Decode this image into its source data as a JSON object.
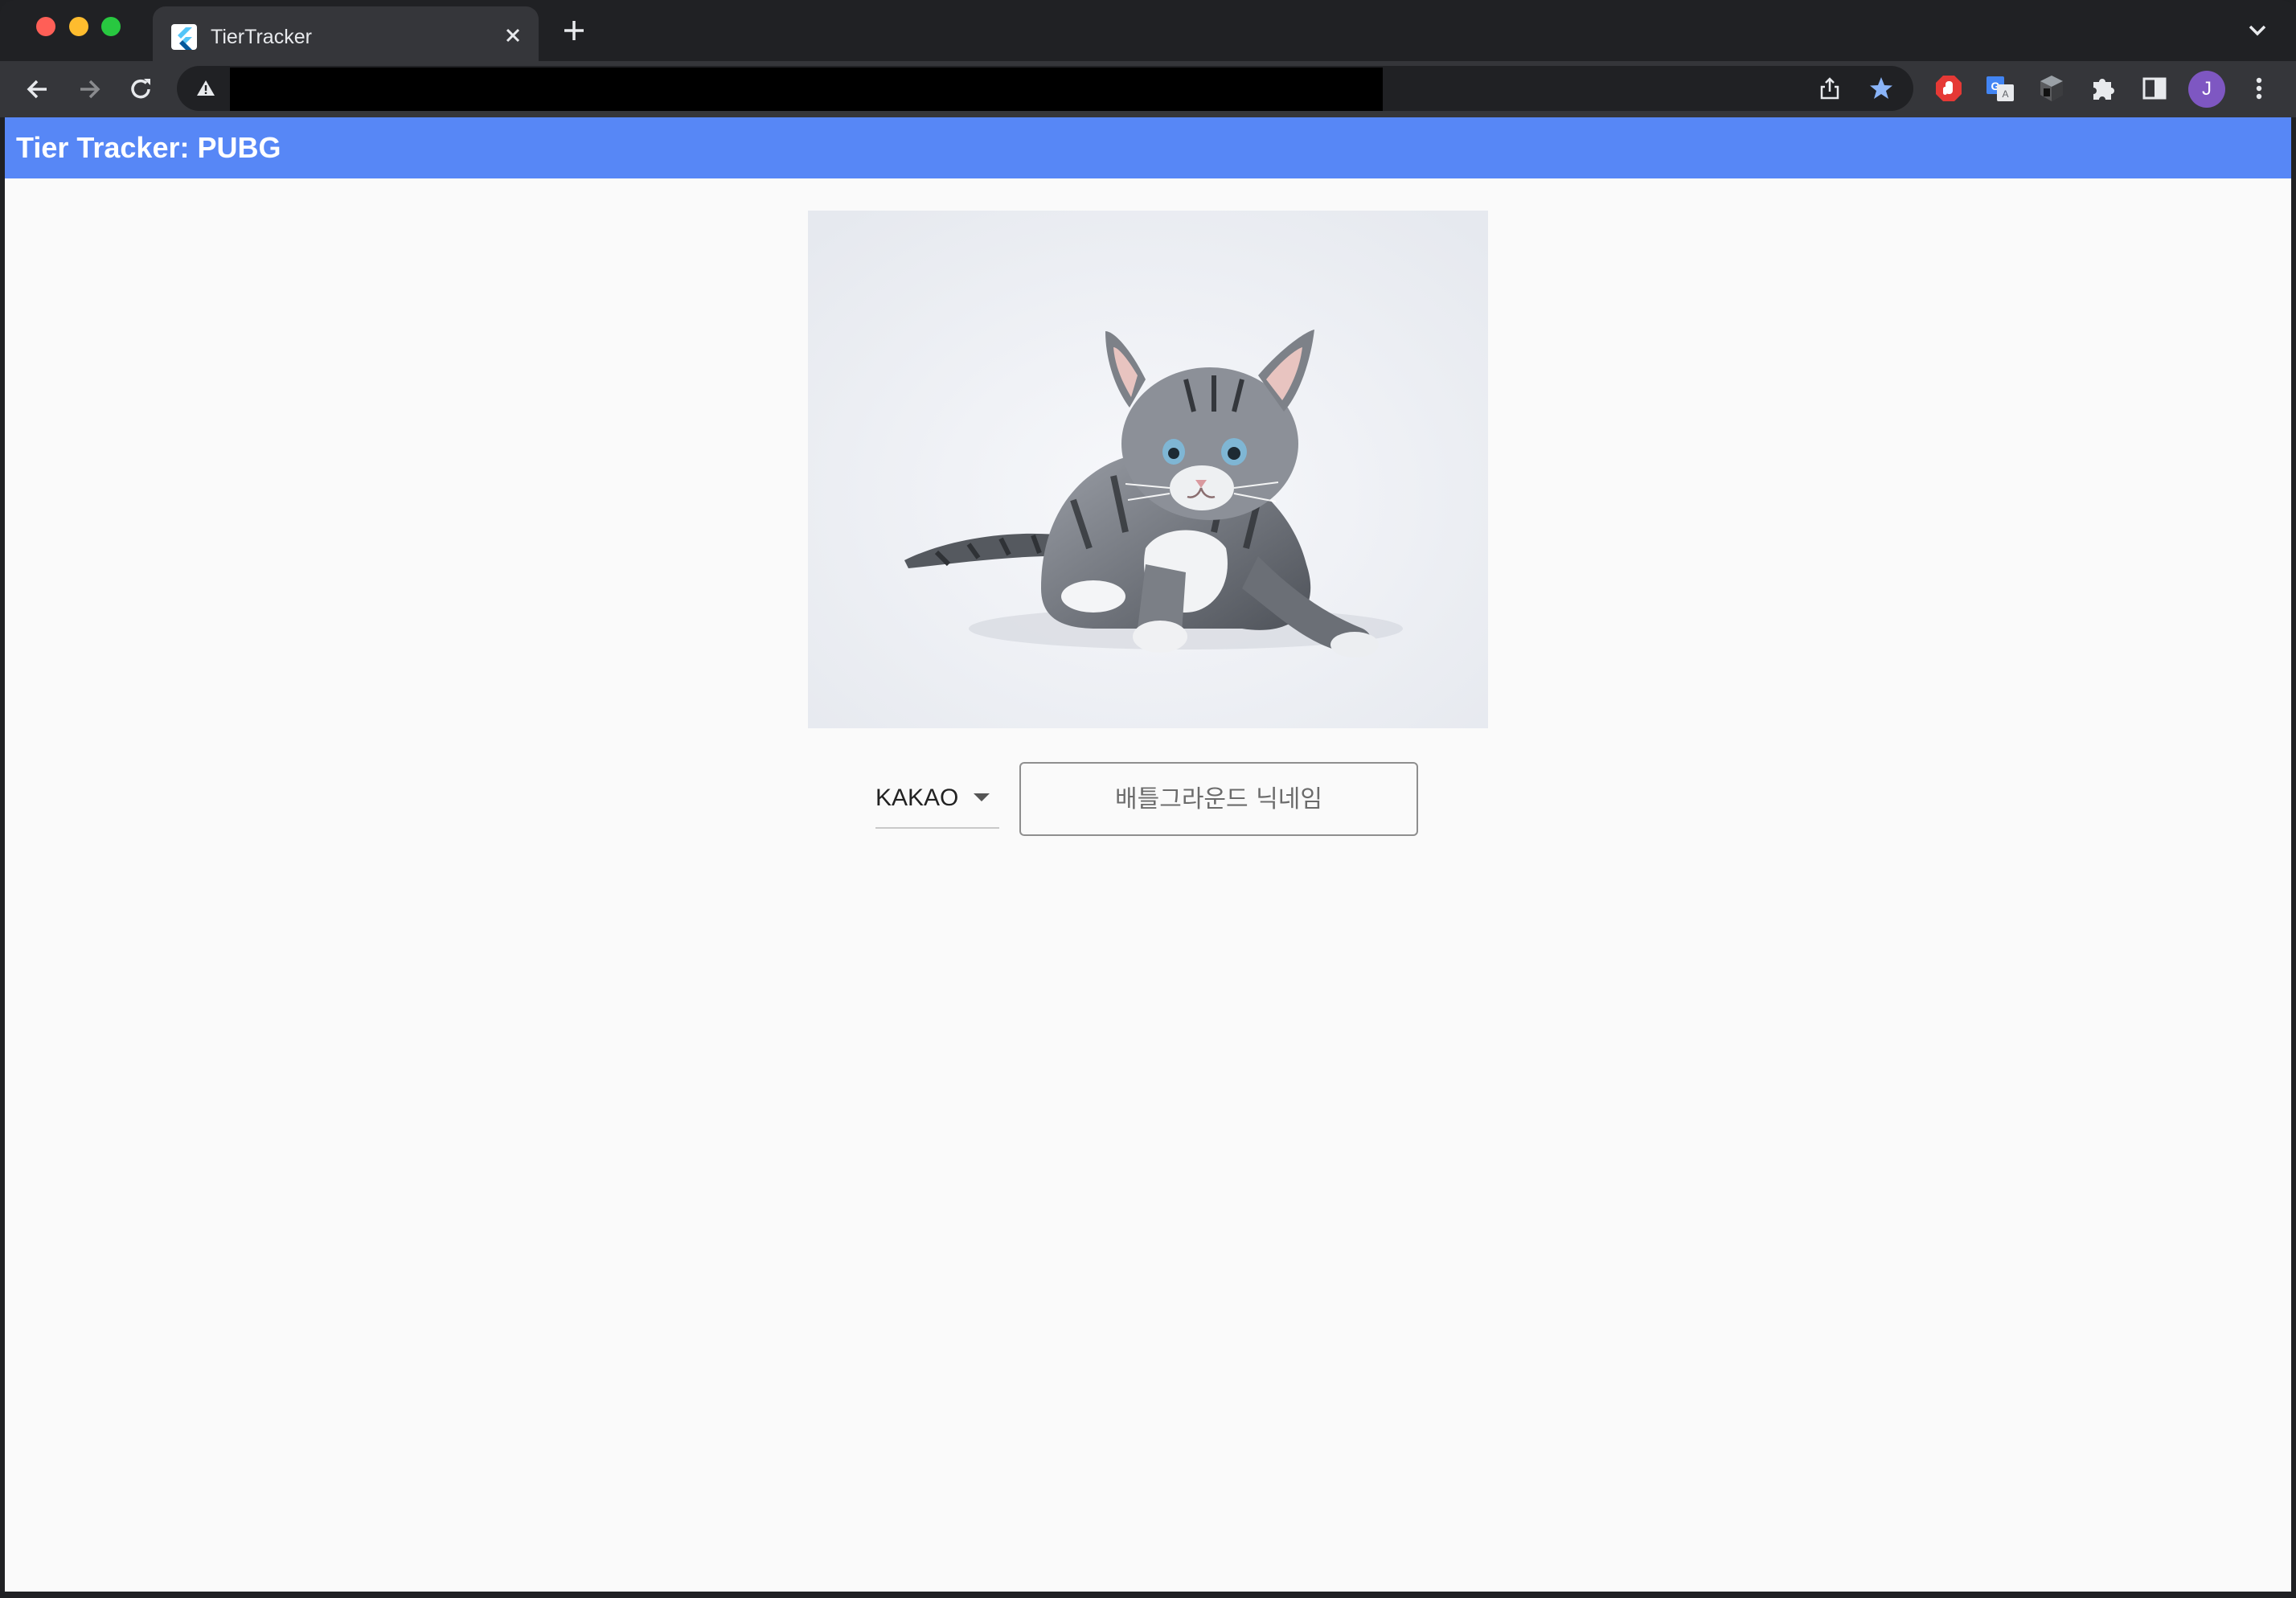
{
  "browser": {
    "tab": {
      "title": "TierTracker",
      "close_icon": "close-icon"
    },
    "new_tab_icon": "plus-icon",
    "tab_search_icon": "chevron-down-icon",
    "toolbar": {
      "back_icon": "arrow-left-icon",
      "forward_icon": "arrow-right-icon",
      "reload_icon": "reload-icon",
      "security_icon": "warning-icon",
      "share_icon": "share-icon",
      "bookmark_icon": "star-icon",
      "extensions": [
        "adblock-icon",
        "translate-icon",
        "cube-extension-icon",
        "puzzle-icon",
        "side-panel-icon"
      ],
      "profile_initial": "J",
      "menu_icon": "kebab-menu-icon"
    },
    "colors": {
      "frame": "#202124",
      "toolbar": "#35363a",
      "bookmark_star": "#8ab4f8",
      "profile": "#7e57c2"
    }
  },
  "app": {
    "appbar": {
      "title": "Tier Tracker: PUBG",
      "color": "#5787f6"
    },
    "hero_image": {
      "subject": "kitten"
    },
    "platform_select": {
      "value": "KAKAO"
    },
    "nickname_input": {
      "placeholder": "배틀그라운드 닉네임",
      "value": ""
    }
  }
}
